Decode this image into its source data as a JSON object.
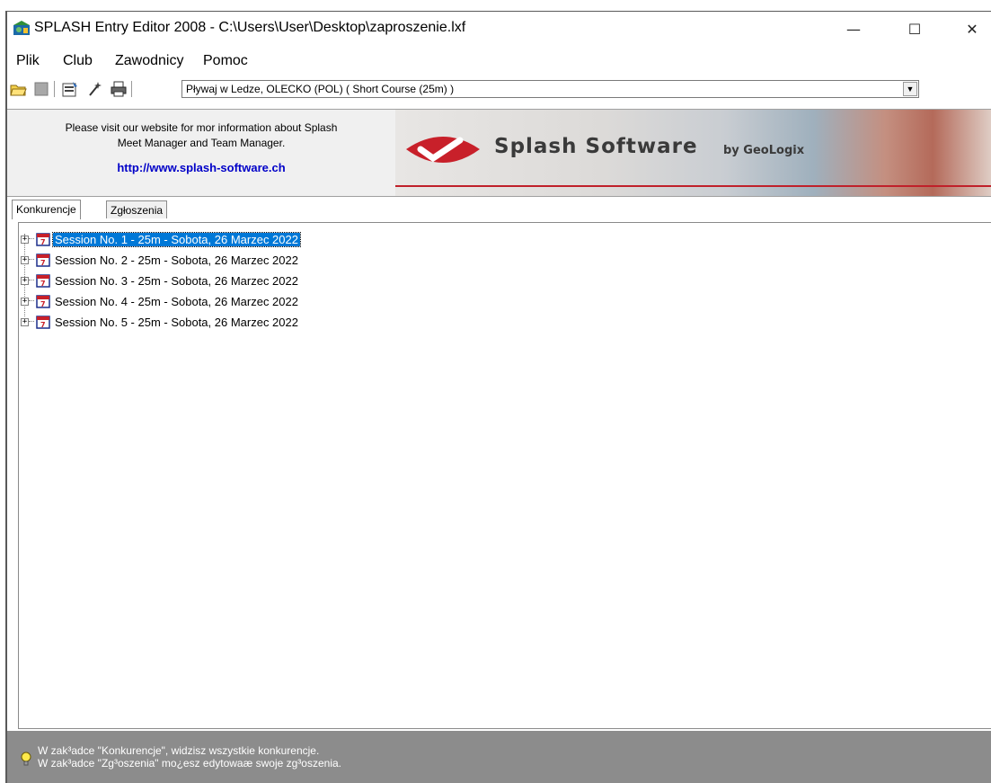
{
  "top_fragment": "",
  "window": {
    "title": "SPLASH Entry Editor 2008 - C:\\Users\\User\\Desktop\\zaproszenie.lxf",
    "min_glyph": "—",
    "max_glyph": "☐",
    "close_glyph": "✕"
  },
  "menu": [
    "Plik",
    "Club",
    "Zawodnicy",
    "Pomoc"
  ],
  "toolbar": {
    "icons": [
      "open-folder-icon",
      "stop-icon",
      "properties-icon",
      "magic-wand-icon",
      "print-icon"
    ],
    "meet_combo_value": "Pływaj w Ledze,  OLECKO  (POL)   ( Short Course (25m) )",
    "combo_arrow": "▼"
  },
  "banner": {
    "info_line1": "Please visit our website for mor information about Splash",
    "info_line2": "Meet Manager and Team Manager.",
    "link": "http://www.splash-software.ch",
    "brand": "Splash Software",
    "brand_by": "by GeoLogix"
  },
  "tabs": [
    {
      "label": "Konkurencje",
      "active": true
    },
    {
      "label": "Zgłoszenia",
      "active": false
    }
  ],
  "sessions": [
    "Session No. 1 - 25m - Sobota, 26 Marzec 2022",
    "Session No. 2 - 25m - Sobota, 26 Marzec 2022",
    "Session No. 3 - 25m - Sobota, 26 Marzec 2022",
    "Session No. 4 - 25m - Sobota, 26 Marzec 2022",
    "Session No. 5 - 25m - Sobota, 26 Marzec 2022"
  ],
  "selected_session": 1,
  "status": {
    "line1": "W zak³adce \"Konkurencje\", widzisz wszystkie konkurencje.",
    "line2": "W zak³adce \"Zg³oszenia\" mo¿esz edytowaæ swoje zg³oszenia."
  },
  "colors": {
    "selection": "#0078d7",
    "link": "#0000c8",
    "status_bg": "#8c8c8c",
    "banner_red": "#c0202a"
  }
}
